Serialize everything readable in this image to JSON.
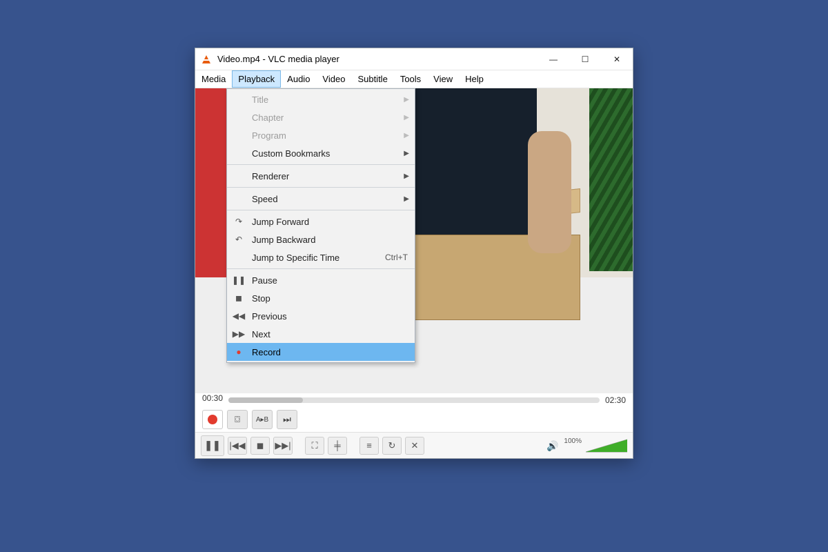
{
  "window": {
    "title": "Video.mp4 - VLC media player"
  },
  "menubar": {
    "items": [
      "Media",
      "Playback",
      "Audio",
      "Video",
      "Subtitle",
      "Tools",
      "View",
      "Help"
    ],
    "open_index": 1
  },
  "dropdown": {
    "groups": [
      [
        {
          "label": "Title",
          "disabled": true,
          "submenu": true
        },
        {
          "label": "Chapter",
          "disabled": true,
          "submenu": true
        },
        {
          "label": "Program",
          "disabled": true,
          "submenu": true
        },
        {
          "label": "Custom Bookmarks",
          "submenu": true
        }
      ],
      [
        {
          "label": "Renderer",
          "submenu": true
        }
      ],
      [
        {
          "label": "Speed",
          "submenu": true
        }
      ],
      [
        {
          "icon": "jump-forward",
          "label": "Jump Forward"
        },
        {
          "icon": "jump-backward",
          "label": "Jump Backward"
        },
        {
          "label": "Jump to Specific Time",
          "accel": "Ctrl+T"
        }
      ],
      [
        {
          "icon": "pause",
          "label": "Pause"
        },
        {
          "icon": "stop",
          "label": "Stop"
        },
        {
          "icon": "previous",
          "label": "Previous"
        },
        {
          "icon": "next",
          "label": "Next"
        },
        {
          "icon": "record",
          "label": "Record",
          "highlight": true
        }
      ]
    ]
  },
  "seek": {
    "elapsed": "00:30",
    "total": "02:30",
    "percent": 20
  },
  "advanced_bar": {
    "record": "record",
    "others": [
      "snapshot",
      "ab-loop",
      "frame-step"
    ]
  },
  "controls": {
    "buttons": [
      {
        "name": "pause",
        "glyph": "❚❚",
        "big": true
      },
      {
        "name": "previous",
        "glyph": "|◀◀"
      },
      {
        "name": "stop",
        "glyph": "◼"
      },
      {
        "name": "next",
        "glyph": "▶▶|"
      },
      {
        "gap": true
      },
      {
        "name": "fullscreen",
        "glyph": "⛶"
      },
      {
        "name": "extended",
        "glyph": "╪"
      },
      {
        "gap": true
      },
      {
        "name": "playlist",
        "glyph": "≡"
      },
      {
        "name": "loop",
        "glyph": "↻"
      },
      {
        "name": "shuffle",
        "glyph": "✕"
      }
    ]
  },
  "volume": {
    "label": "100%",
    "percent": 100
  }
}
